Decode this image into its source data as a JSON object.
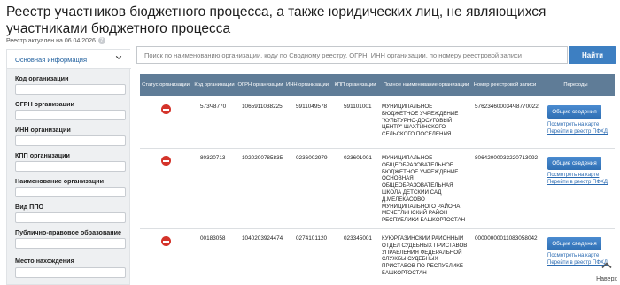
{
  "page": {
    "title": "Реестр участников бюджетного процесса, а также юридических лиц, не являющихся участниками бюджетного процесса",
    "actual_date": "Реестр актуален на 06.04.2026"
  },
  "sidebar": {
    "header": "Основная информация",
    "fields": [
      {
        "label": "Код организации"
      },
      {
        "label": "ОГРН организации"
      },
      {
        "label": "ИНН организации"
      },
      {
        "label": "КПП организации"
      },
      {
        "label": "Наименование организации"
      },
      {
        "label": "Вид ППО"
      },
      {
        "label": "Публично-правовое образование"
      },
      {
        "label": "Место нахождения"
      }
    ]
  },
  "search": {
    "placeholder": "Поиск по наименованию организации, коду по Сводному реестру, ОГРН, ИНН организации, по номеру реестровой записи",
    "button": "Найти"
  },
  "table": {
    "columns": [
      "Статус организации",
      "Код организации",
      "ОГРН организации",
      "ИНН организации",
      "КПП организации",
      "Полное наименование организации",
      "Номер реестровой записи",
      "Переходы"
    ],
    "details_label": "Общие сведения",
    "map_link": "Посмотреть на карте",
    "pfhd_link": "Перейти в реестр ПФХД",
    "rows": [
      {
        "code": "573Ч8770",
        "ogrn": "1065911038225",
        "inn": "5911049578",
        "kpp": "591101001",
        "name": "МУНИЦИПАЛЬНОЕ БЮДЖЕТНОЕ УЧРЕЖДЕНИЕ \"КУЛЬТУРНО-ДОСУГОВЫЙ ЦЕНТР\" ШАХТИНСКОГО СЕЛЬСКОГО ПОСЕЛЕНИЯ",
        "record": "576234600034Ч8770022"
      },
      {
        "code": "80320713",
        "ogrn": "1020200785835",
        "inn": "0236002979",
        "kpp": "023601001",
        "name": "МУНИЦИПАЛЬНОЕ ОБЩЕОБРАЗОВАТЕЛЬНОЕ БЮДЖЕТНОЕ УЧРЕЖДЕНИЕ ОСНОВНАЯ ОБЩЕОБРАЗОВАТЕЛЬНАЯ ШКОЛА ДЕТСКИЙ САД Д.МЕЛЕКАСОВО МУНИЦИПАЛЬНОГО РАЙОНА МЕЧЕТЛИНСКИЙ РАЙОН РЕСПУБЛИКИ БАШКОРТОСТАН",
        "record": "80642000033220713092"
      },
      {
        "code": "00183058",
        "ogrn": "1040203924474",
        "inn": "0274101120",
        "kpp": "023345001",
        "name": "КУЮРГАЗИНСКИЙ РАЙОННЫЙ ОТДЕЛ СУДЕБНЫХ ПРИСТАВОВ УПРАВЛЕНИЯ ФЕДЕРАЛЬНОЙ СЛУЖБЫ СУДЕБНЫХ ПРИСТАВОВ ПО РЕСПУБЛИКЕ БАШКОРТОСТАН",
        "record": "00000000011083058042"
      }
    ]
  },
  "back_to_top": "Наверх"
}
